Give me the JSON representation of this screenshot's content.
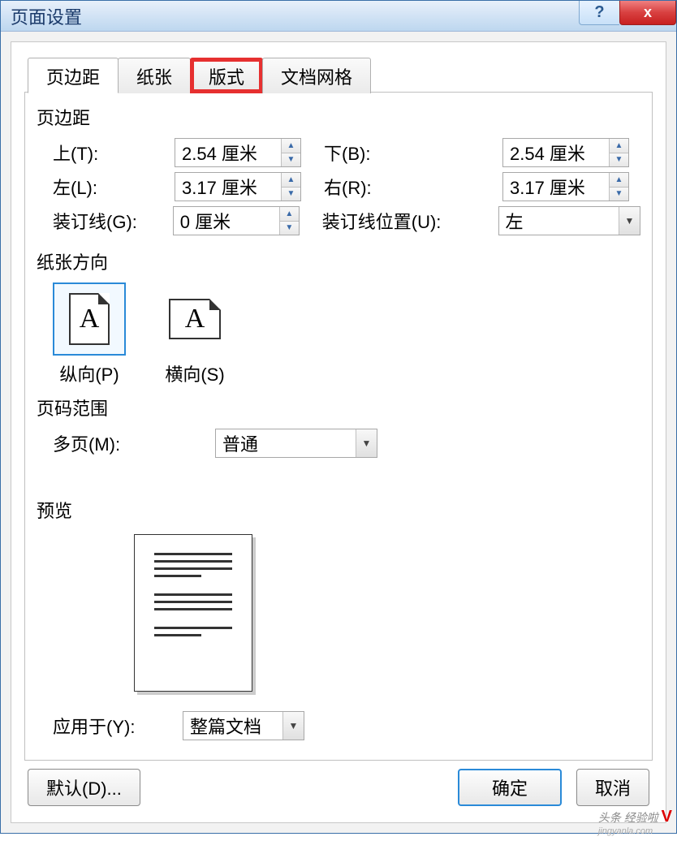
{
  "window": {
    "title": "页面设置",
    "help_char": "?",
    "close_char": "x"
  },
  "tabs": [
    "页边距",
    "纸张",
    "版式",
    "文档网格"
  ],
  "margins": {
    "group_title": "页边距",
    "top_label": "上(T):",
    "top_value": "2.54 厘米",
    "bottom_label": "下(B):",
    "bottom_value": "2.54 厘米",
    "left_label": "左(L):",
    "left_value": "3.17 厘米",
    "right_label": "右(R):",
    "right_value": "3.17 厘米",
    "gutter_label": "装订线(G):",
    "gutter_value": "0 厘米",
    "gutter_pos_label": "装订线位置(U):",
    "gutter_pos_value": "左"
  },
  "orientation": {
    "group_title": "纸张方向",
    "portrait_label": "纵向(P)",
    "landscape_label": "横向(S)"
  },
  "page_range": {
    "group_title": "页码范围",
    "multi_label": "多页(M):",
    "multi_value": "普通"
  },
  "preview": {
    "group_title": "预览",
    "apply_label": "应用于(Y):",
    "apply_value": "整篇文档"
  },
  "footer": {
    "default_btn": "默认(D)...",
    "ok_btn": "确定",
    "cancel_btn": "取消"
  },
  "watermark": {
    "text": "头条 经验啦",
    "v": "V",
    "url": "jingyanla.com"
  }
}
